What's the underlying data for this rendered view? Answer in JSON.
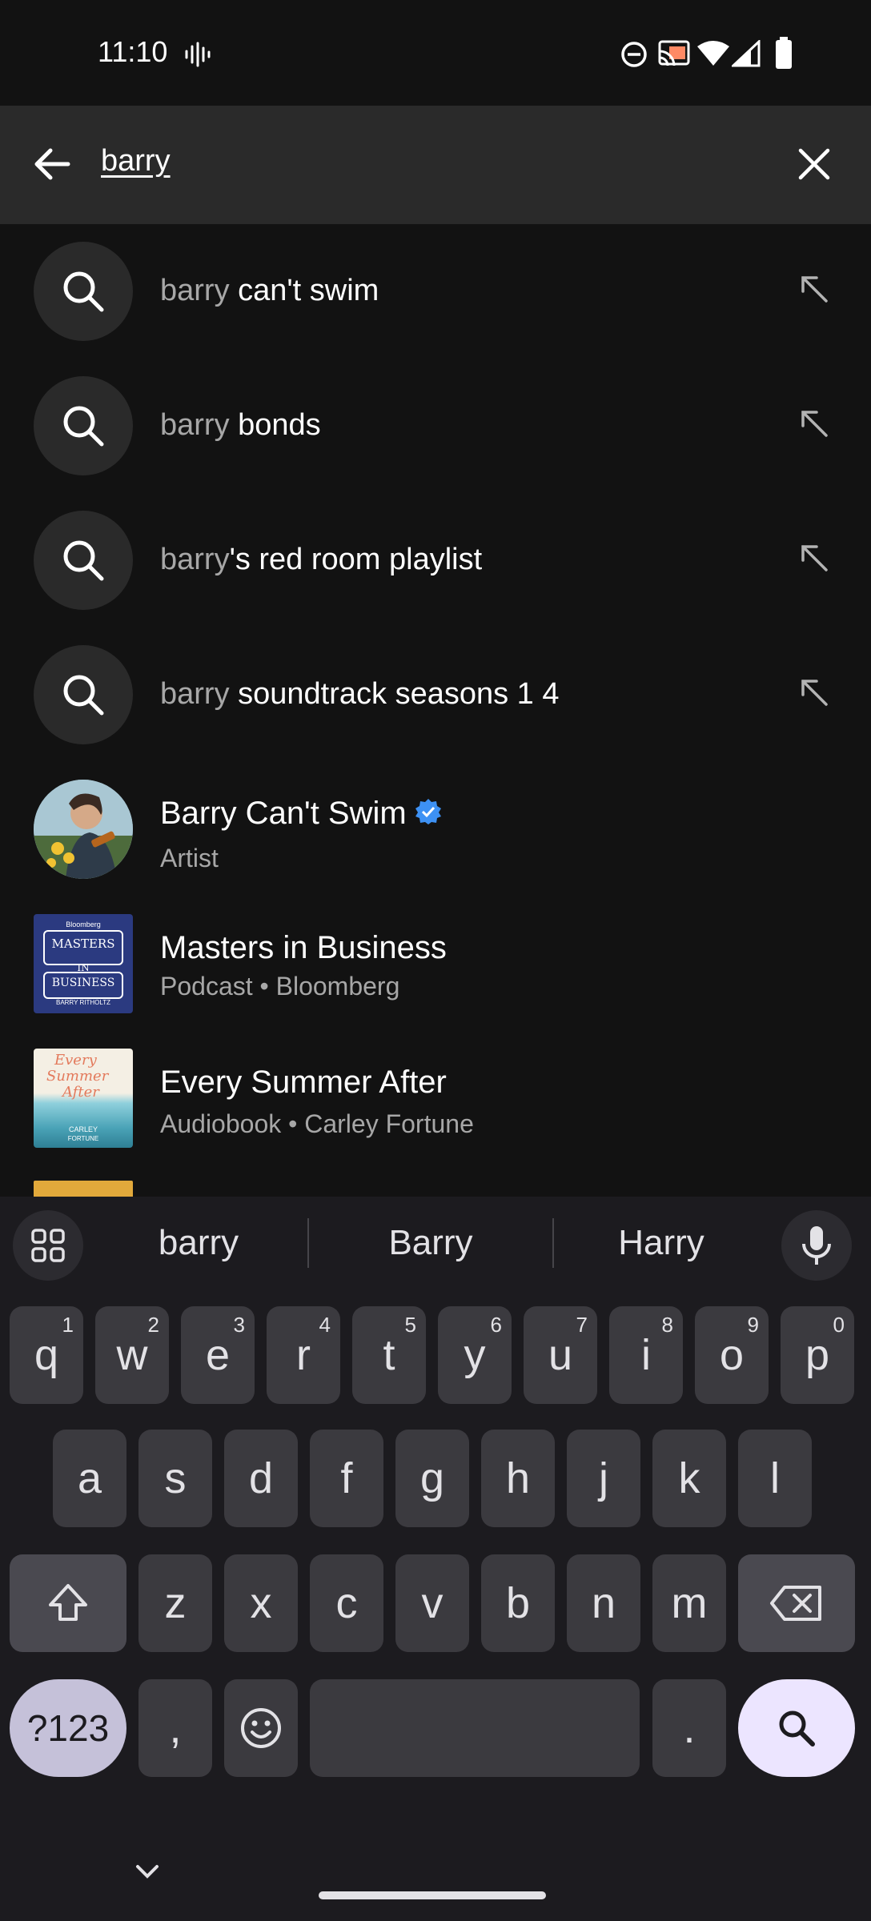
{
  "status_bar": {
    "time": "11:10"
  },
  "search": {
    "query": "barry"
  },
  "suggestions": [
    {
      "prefix": "barry",
      "rest": " can't swim"
    },
    {
      "prefix": "barry",
      "rest": " bonds"
    },
    {
      "prefix": "barry",
      "rest": "'s red room playlist"
    },
    {
      "prefix": "barry",
      "rest": " soundtrack seasons 1 4"
    }
  ],
  "results": [
    {
      "title": "Barry Can't Swim",
      "subtitle": "Artist",
      "verified": true
    },
    {
      "title": "Masters in Business",
      "subtitle": "Podcast • Bloomberg",
      "thumb_text_1": "MASTERS",
      "thumb_text_2": "IN",
      "thumb_text_3": "BUSINESS",
      "thumb_text_4": "BARRY RITHOLTZ",
      "thumb_text_0": "Bloomberg"
    },
    {
      "title": "Every Summer After",
      "subtitle": "Audiobook • Carley Fortune",
      "thumb_text_1": "Every",
      "thumb_text_2": "Summer",
      "thumb_text_3": "After",
      "thumb_text_4": "CARLEY",
      "thumb_text_5": "FORTUNE"
    }
  ],
  "keyboard": {
    "suggestions": [
      "barry",
      "Barry",
      "Harry"
    ],
    "row1": [
      {
        "k": "q",
        "n": "1"
      },
      {
        "k": "w",
        "n": "2"
      },
      {
        "k": "e",
        "n": "3"
      },
      {
        "k": "r",
        "n": "4"
      },
      {
        "k": "t",
        "n": "5"
      },
      {
        "k": "y",
        "n": "6"
      },
      {
        "k": "u",
        "n": "7"
      },
      {
        "k": "i",
        "n": "8"
      },
      {
        "k": "o",
        "n": "9"
      },
      {
        "k": "p",
        "n": "0"
      }
    ],
    "row2": [
      "a",
      "s",
      "d",
      "f",
      "g",
      "h",
      "j",
      "k",
      "l"
    ],
    "row3": [
      "z",
      "x",
      "c",
      "v",
      "b",
      "n",
      "m"
    ],
    "sym_label": "?123",
    "comma": ",",
    "period": "."
  },
  "colors": {
    "background": "#121212",
    "header": "#2a2a2a",
    "verified": "#3d91f4",
    "keyboard": "#1c1b1f"
  }
}
